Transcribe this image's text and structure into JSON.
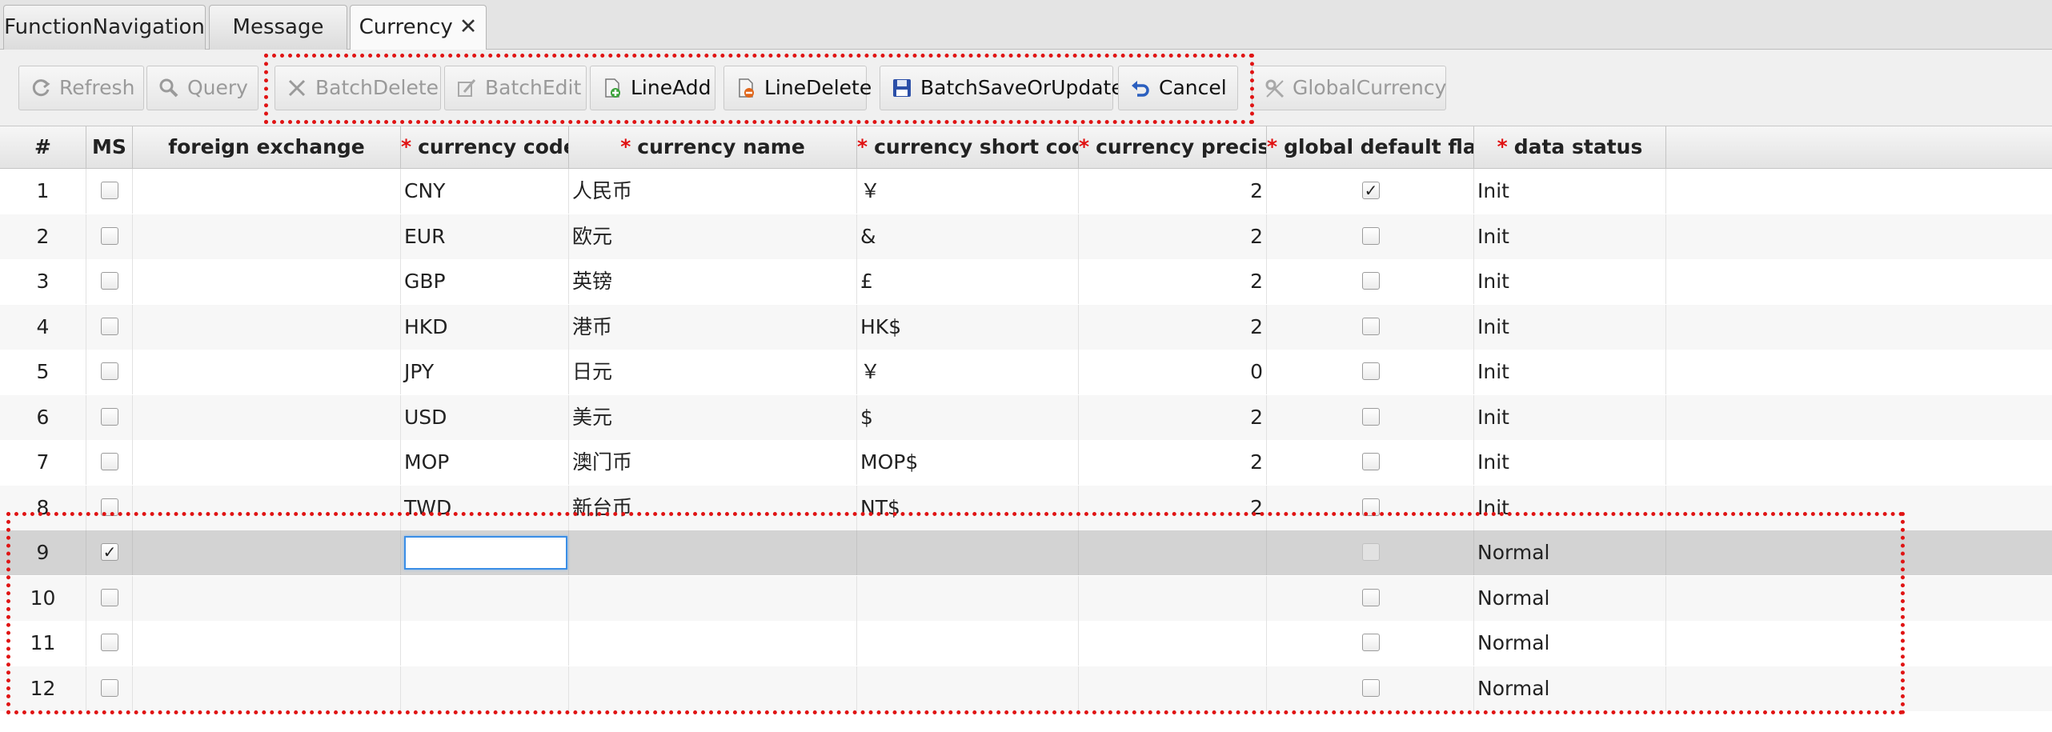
{
  "tabs": [
    {
      "label": "FunctionNavigation"
    },
    {
      "label": "Message"
    },
    {
      "label": "Currency",
      "close": "✕"
    }
  ],
  "toolbar": {
    "refresh": "Refresh",
    "query": "Query",
    "batch_delete": "BatchDelete",
    "batch_edit": "BatchEdit",
    "line_add": "LineAdd",
    "line_delete": "LineDelete",
    "batch_save": "BatchSaveOrUpdate",
    "cancel": "Cancel",
    "global_currency": "GlobalCurrency"
  },
  "table": {
    "required_mark": "*",
    "headers": {
      "num": "#",
      "ms": "MS",
      "foreign_exchange": "foreign exchange",
      "currency_code": "currency code",
      "currency_name": "currency name",
      "currency_short_code": "currency short code",
      "currency_precise": "currency precise",
      "global_default_flag": "global default flag",
      "data_status": "data status"
    },
    "rows": [
      {
        "num": "1",
        "ms": false,
        "fx": "",
        "code": "CNY",
        "name": "人民币",
        "short": "￥",
        "precise": "2",
        "global": true,
        "status": "Init"
      },
      {
        "num": "2",
        "ms": false,
        "fx": "",
        "code": "EUR",
        "name": "欧元",
        "short": "&",
        "precise": "2",
        "global": false,
        "status": "Init"
      },
      {
        "num": "3",
        "ms": false,
        "fx": "",
        "code": "GBP",
        "name": "英镑",
        "short": "£",
        "precise": "2",
        "global": false,
        "status": "Init"
      },
      {
        "num": "4",
        "ms": false,
        "fx": "",
        "code": "HKD",
        "name": "港币",
        "short": "HK$",
        "precise": "2",
        "global": false,
        "status": "Init"
      },
      {
        "num": "5",
        "ms": false,
        "fx": "",
        "code": "JPY",
        "name": "日元",
        "short": "￥",
        "precise": "0",
        "global": false,
        "status": "Init"
      },
      {
        "num": "6",
        "ms": false,
        "fx": "",
        "code": "USD",
        "name": "美元",
        "short": "$",
        "precise": "2",
        "global": false,
        "status": "Init"
      },
      {
        "num": "7",
        "ms": false,
        "fx": "",
        "code": "MOP",
        "name": "澳门币",
        "short": "MOP$",
        "precise": "2",
        "global": false,
        "status": "Init"
      },
      {
        "num": "8",
        "ms": false,
        "fx": "",
        "code": "TWD",
        "name": "新台币",
        "short": "NT$",
        "precise": "2",
        "global": false,
        "status": "Init"
      },
      {
        "num": "9",
        "ms": true,
        "fx": "",
        "code": "",
        "name": "",
        "short": "",
        "precise": "",
        "global": false,
        "status": "Normal",
        "editing": true
      },
      {
        "num": "10",
        "ms": false,
        "fx": "",
        "code": "",
        "name": "",
        "short": "",
        "precise": "",
        "global": false,
        "status": "Normal"
      },
      {
        "num": "11",
        "ms": false,
        "fx": "",
        "code": "",
        "name": "",
        "short": "",
        "precise": "",
        "global": false,
        "status": "Normal"
      },
      {
        "num": "12",
        "ms": false,
        "fx": "",
        "code": "",
        "name": "",
        "short": "",
        "precise": "",
        "global": false,
        "status": "Normal"
      }
    ],
    "editing_input_value": ""
  },
  "colors": {
    "highlight": "#e01414",
    "required": "#e01010",
    "selected_row": "#d3d3d3",
    "focus_border": "#3a8ee6"
  },
  "icons": {
    "refresh": "refresh-icon",
    "query": "magnifier-icon",
    "batch_delete": "x-icon",
    "batch_edit": "pencil-icon",
    "line_add": "doc-add-icon",
    "line_delete": "doc-remove-icon",
    "batch_save": "floppy-disk-icon",
    "cancel": "undo-icon",
    "global_currency": "tools-icon"
  }
}
